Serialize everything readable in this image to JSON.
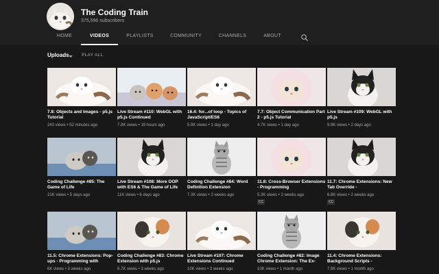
{
  "channel": {
    "name": "The Coding Train",
    "subscribers": "375,596 subscribers"
  },
  "tabs": [
    "HOME",
    "VIDEOS",
    "PLAYLISTS",
    "COMMUNITY",
    "CHANNELS",
    "ABOUT"
  ],
  "active_tab": "VIDEOS",
  "uploads": {
    "label": "Uploads",
    "play_all": "PLAY ALL"
  },
  "videos": [
    {
      "title": "7.8: Objects and Images - p5.js Tutorial",
      "views": "243 views",
      "age": "52 minutes ago",
      "thumb": "white-kitten"
    },
    {
      "title": "Live Stream #110: WebGL with p5.js Continued",
      "views": "7.8K views",
      "age": "19 hours ago",
      "thumb": "three-kittens"
    },
    {
      "title": "16.4: for...of loop - Topics of JavaScript/ES6",
      "views": "5.9K views",
      "age": "1 day ago",
      "thumb": "white-kitten"
    },
    {
      "title": "7.7: Object Communication Part 2 - p5.js Tutorial",
      "views": "4.7K views",
      "age": "1 day ago",
      "thumb": "hooded-kitten"
    },
    {
      "title": "Live Stream #109: WebGL with p5.js",
      "views": "9.9K views",
      "age": "2 days ago",
      "thumb": "tuxedo-kitten"
    },
    {
      "title": "Coding Challenge #85: The Game of Life",
      "views": "21K views",
      "age": "5 days ago",
      "thumb": "basket-kittens"
    },
    {
      "title": "Live Stream #108: More OOP with ES6 & The Game of Life",
      "views": "11K views",
      "age": "6 days ago",
      "thumb": "tuxedo-kitten"
    },
    {
      "title": "Coding Challenge #84: Word Definition Extension",
      "views": "7.3K views",
      "age": "2 weeks ago",
      "thumb": "tabby-kitten"
    },
    {
      "title": "11.8: Cross-Browser Extensions - Programming",
      "views": "5.3K views",
      "age": "2 weeks ago",
      "thumb": "hooded-kitten",
      "cc": "CC"
    },
    {
      "title": "11.7: Chrome Extensions: New Tab Override -",
      "views": "6.8K views",
      "age": "2 weeks ago",
      "thumb": "tuxedo-kitten",
      "cc": "CC"
    },
    {
      "title": "11.5: Chrome Extensions: Pop-ups - Programming with",
      "views": "6K views",
      "age": "3 weeks ago",
      "thumb": "basket-kittens"
    },
    {
      "title": "Coding Challenge #83: Chrome Extension with p5.js",
      "views": "6.7K views",
      "age": "3 weeks ago",
      "thumb": "calico-kitten"
    },
    {
      "title": "Live Stream #107: Chrome Extensions Continued",
      "views": "10K views",
      "age": "3 weeks ago",
      "thumb": "white-kitten"
    },
    {
      "title": "Coding Challenge #82: Image Chrome Extension: The Ex-",
      "views": "10K views",
      "age": "1 month ago",
      "thumb": "tabby-kitten"
    },
    {
      "title": "11.4: Chrome Extensions: Background Scripts -",
      "views": "7.8K views",
      "age": "1 month ago",
      "thumb": "calico-kitten"
    }
  ],
  "colors": {
    "background": "#181818",
    "header": "#1f1f1f",
    "text_primary": "#ffffff",
    "text_secondary": "#aaaaaa",
    "active_underline": "#ffffff"
  }
}
